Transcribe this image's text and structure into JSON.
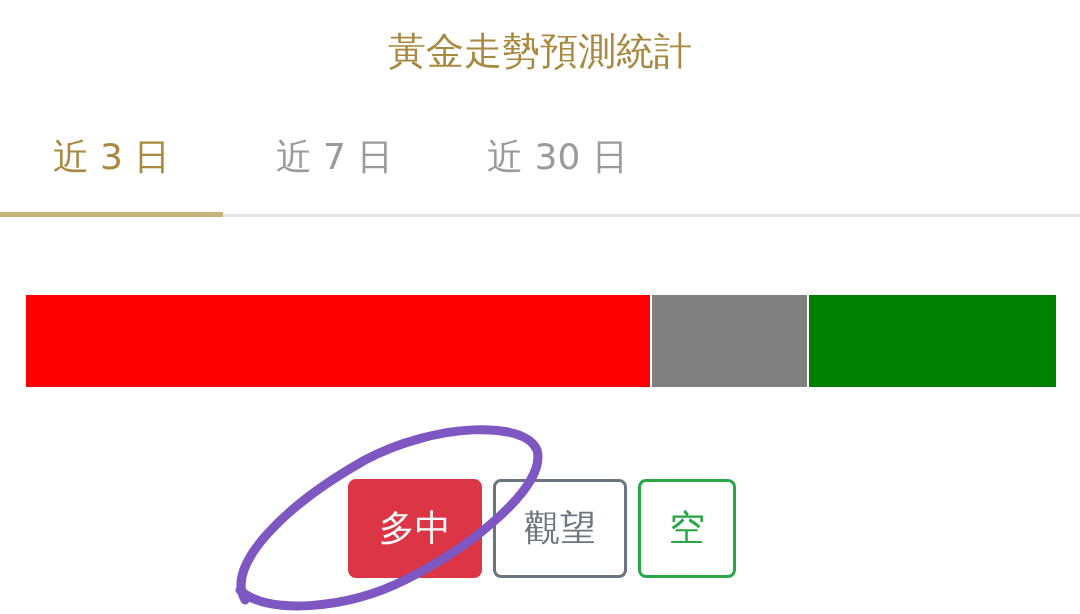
{
  "title": "黃金走勢預測統計",
  "tabs": [
    {
      "label": "近 3 日",
      "selected": true
    },
    {
      "label": "近 7 日",
      "selected": false
    },
    {
      "label": "近 30 日",
      "selected": false
    }
  ],
  "bar": {
    "color": "#808080",
    "fills": [
      {
        "level": 0.608,
        "color": "#ff0000",
        "kind": "start"
      },
      {
        "level": 0.242,
        "color": "#008000",
        "kind": "end"
      }
    ]
  },
  "buttons": [
    {
      "label": "多中",
      "color": "#dc3545",
      "selected": true
    },
    {
      "label": "觀望",
      "color": "#6c757d",
      "selected": false
    },
    {
      "label": "空",
      "color": "#28a745",
      "selected": false
    }
  ]
}
